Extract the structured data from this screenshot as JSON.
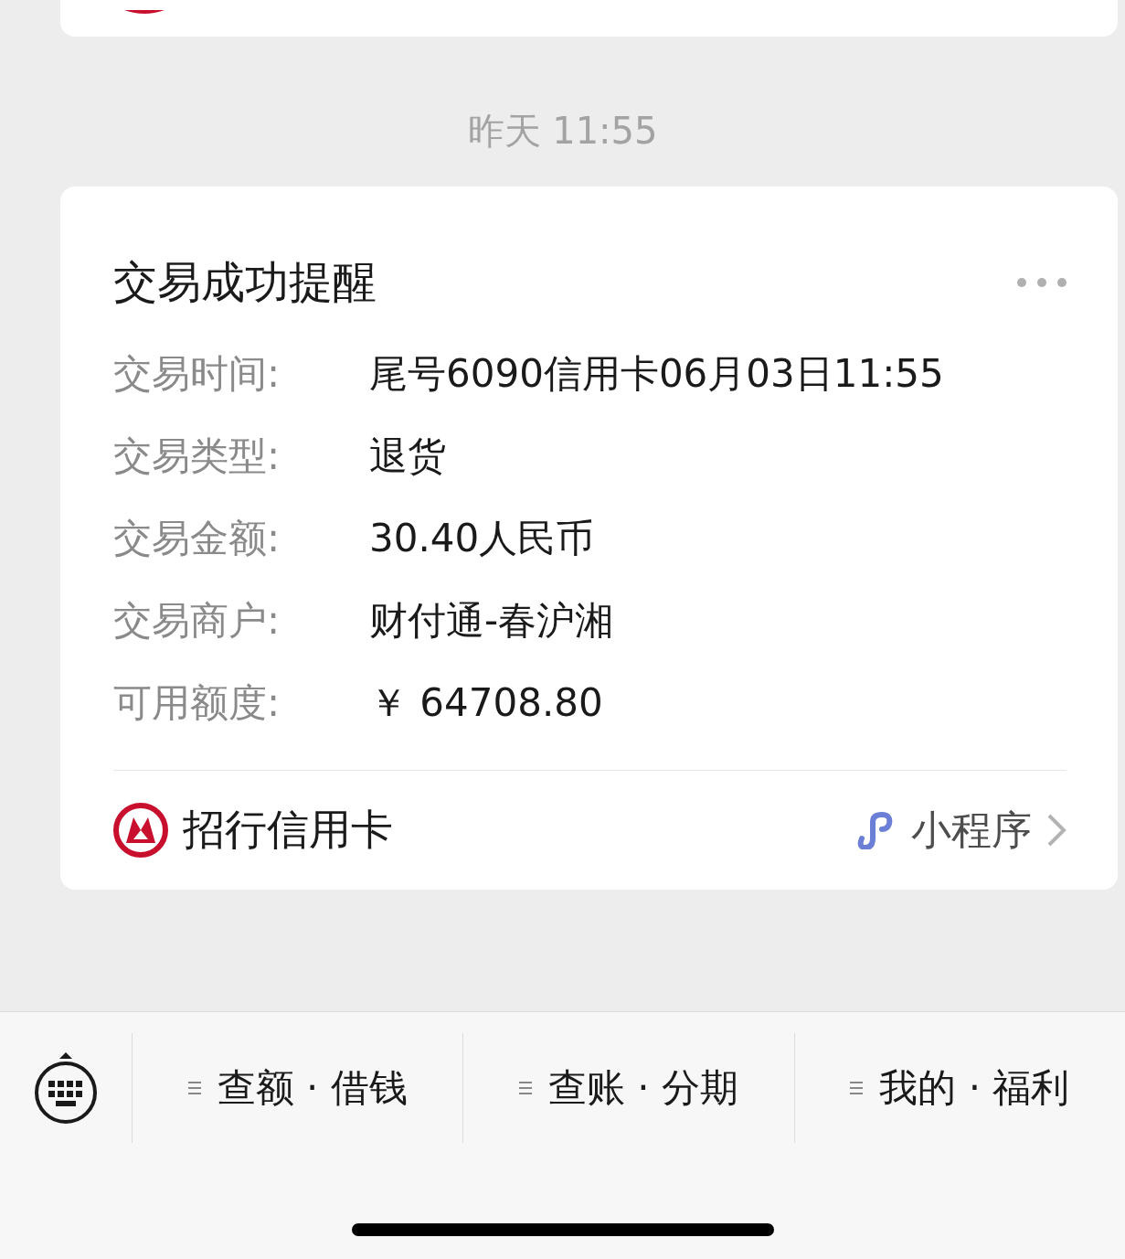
{
  "timestamp": "昨天 11:55",
  "card": {
    "title": "交易成功提醒",
    "rows": [
      {
        "label": "交易时间:",
        "value": "尾号6090信用卡06月03日11:55"
      },
      {
        "label": "交易类型:",
        "value": "退货"
      },
      {
        "label": "交易金额:",
        "value": "30.40人民币"
      },
      {
        "label": "交易商户:",
        "value": "财付通-春沪湘"
      },
      {
        "label": "可用额度:",
        "value": "￥ 64708.80"
      }
    ],
    "source": "招行信用卡",
    "link": "小程序"
  },
  "menu": [
    {
      "label": "查额 · 借钱"
    },
    {
      "label": "查账 · 分期"
    },
    {
      "label": "我的 · 福利"
    }
  ]
}
